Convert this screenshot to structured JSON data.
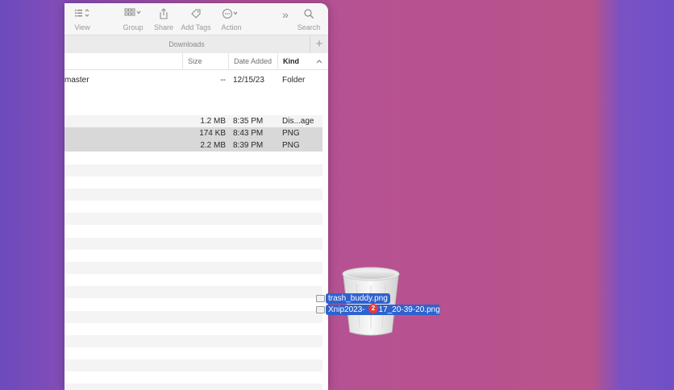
{
  "toolbar": {
    "view_label": "View",
    "group_label": "Group",
    "share_label": "Share",
    "add_tags_label": "Add Tags",
    "action_label": "Action",
    "search_label": "Search"
  },
  "tabs": {
    "active_label": "Downloads",
    "add_label": "+"
  },
  "columns": {
    "size": "Size",
    "date_added": "Date Added",
    "kind": "Kind"
  },
  "rows": [
    {
      "name": "master",
      "size": "--",
      "date": "12/15/23",
      "kind": "Folder"
    },
    {
      "name": "",
      "size": "1.2 MB",
      "date": "8:35 PM",
      "kind": "Dis...age"
    },
    {
      "name": "",
      "size": "174 KB",
      "date": "8:43 PM",
      "kind": "PNG"
    },
    {
      "name": "",
      "size": "2.2 MB",
      "date": "8:39 PM",
      "kind": "PNG"
    }
  ],
  "drag": {
    "items": [
      "trash_buddy.png",
      "Xnip2023-",
      "17_20-39-20.png"
    ],
    "count_badge": "2"
  },
  "colors": {
    "selection": "#2f62cf",
    "badge": "#e33b3b",
    "row_selected": "#d8d8d8"
  }
}
